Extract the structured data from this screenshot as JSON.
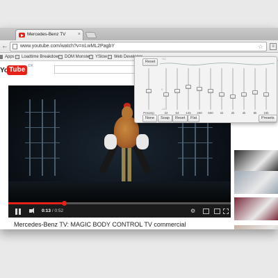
{
  "browser": {
    "tab_title": "Mercedes-Benz TV",
    "tab_close": "×",
    "url": "www.youtube.com/watch?v=nLwML2PagbY",
    "back_icon": "←",
    "star_icon": "☆",
    "ext_icon": "≡",
    "bookmarks": [
      "Apps",
      "Loadtime Breakdown",
      "DOM Monster!",
      "YSlow",
      "Web Developer"
    ]
  },
  "youtube": {
    "logo_you": "You",
    "logo_tube": "Tube",
    "locale": "DK",
    "video_title": "Mercedes-Benz TV: MAGIC BODY CONTROL TV commercial",
    "player": {
      "time_current": "0:13",
      "time_total": "/ 0:52",
      "progress": 0.25
    },
    "sidebar_thumb_colors": [
      "#2a2a2a",
      "#9aa6b2",
      "#7b2a3a",
      "#c9b3a5",
      "#8f93a3"
    ]
  },
  "equalizer": {
    "reset_label": "Reset",
    "preamp_label": "Preamp",
    "bands": [
      {
        "label": "32",
        "level": 0.35
      },
      {
        "label": "64",
        "level": 0.45
      },
      {
        "label": "125",
        "level": 0.55
      },
      {
        "label": "250",
        "level": 0.5
      },
      {
        "label": "500",
        "level": 0.45
      },
      {
        "label": "1k",
        "level": 0.35
      },
      {
        "label": "2k",
        "level": 0.3
      },
      {
        "label": "4k",
        "level": 0.35
      },
      {
        "label": "8k",
        "level": 0.4
      },
      {
        "label": "16k",
        "level": 0.35
      }
    ],
    "preamp_level": 0.45,
    "tick_top": "+12",
    "tick_mid": "0",
    "tick_bottom": "-12",
    "buttons": [
      "None",
      "Soap",
      "Reset",
      "Flat"
    ],
    "presets_label": "Presets"
  }
}
